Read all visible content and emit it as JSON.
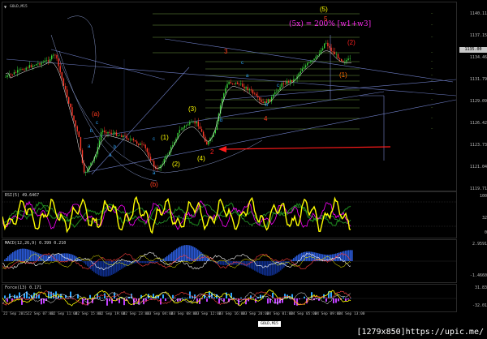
{
  "symbol": "GOLD,M15",
  "callout": "(5x) = 200% [w1+w3]",
  "price_axis": [
    "1140.11",
    "1137.15",
    "1134.46",
    "1131.79",
    "1129.09",
    "1126.42",
    "1123.73",
    "1121.04",
    "1119.71"
  ],
  "last_price": "1135.00",
  "rsi_label": "RSI(5) 49.6467",
  "rsi_scale": [
    "100",
    "32",
    "0"
  ],
  "macd_label": "MACD(12,26,9) 0.399 0.210",
  "macd_scale": [
    "2.9591",
    "-1.4660"
  ],
  "bottom_label": "Force(13) 0.171",
  "bottom_scale": [
    "31.83",
    "-32.01"
  ],
  "time_labels": [
    "22 Sep 2015",
    "22 Sep 07:00",
    "22 Sep 11:00",
    "22 Sep 15:00",
    "22 Sep 19:00",
    "22 Sep 23:00",
    "23 Sep 04:00",
    "23 Sep 08:00",
    "23 Sep 12:00",
    "23 Sep 16:00",
    "23 Sep 20:00",
    "24 Sep 01:00",
    "24 Sep 05:00",
    "24 Sep 09:00",
    "24 Sep 13:00"
  ],
  "footer_pill": "GOLD,M15",
  "source": "[1279x850]https://upic.me/",
  "wave_labels": [
    {
      "t": "(a)",
      "c": "#ff3b1f"
    },
    {
      "t": "(b)",
      "c": "#ff3b1f"
    },
    {
      "t": "(1)",
      "c": "#ffff00"
    },
    {
      "t": "(2)",
      "c": "#ffff00"
    },
    {
      "t": "(3)",
      "c": "#ffff00"
    },
    {
      "t": "(4)",
      "c": "#ffff00"
    },
    {
      "t": "(5)",
      "c": "#ffff00"
    },
    {
      "t": "3",
      "c": "#ff3b1f"
    },
    {
      "t": "4",
      "c": "#ff3b1f"
    },
    {
      "t": "5",
      "c": "#ff3b1f"
    },
    {
      "t": "(2)",
      "c": "#ff2020"
    },
    {
      "t": "(1)",
      "c": "#ff6a00"
    },
    {
      "t": "2",
      "c": "#ff2020"
    },
    {
      "t": "a",
      "c": "#2ea7ff"
    },
    {
      "t": "b",
      "c": "#2ea7ff"
    },
    {
      "t": "c",
      "c": "#2ea7ff"
    },
    {
      "t": "a",
      "c": "#2ea7ff"
    },
    {
      "t": "b",
      "c": "#2ea7ff"
    },
    {
      "t": "c",
      "c": "#2ea7ff"
    },
    {
      "t": "a",
      "c": "#2ea7ff"
    },
    {
      "t": "b",
      "c": "#2ea7ff"
    },
    {
      "t": "c",
      "c": "#2ea7ff"
    },
    {
      "t": "a",
      "c": "#2ea7ff"
    },
    {
      "t": "b",
      "c": "#2ea7ff"
    },
    {
      "t": "c",
      "c": "#2ea7ff"
    }
  ],
  "colors": {
    "bull": "#39d13a",
    "bear": "#ff3a2a",
    "ma": "#ffffff",
    "trend": "#6f7fc8",
    "fib": "#6f9b3f",
    "arrow": "#ff1a1a",
    "rsi": "#ffff00",
    "rsi2": "#ff00ff",
    "hist_up": "#2a5ad8",
    "hist_dn": "#0f2e8c"
  }
}
